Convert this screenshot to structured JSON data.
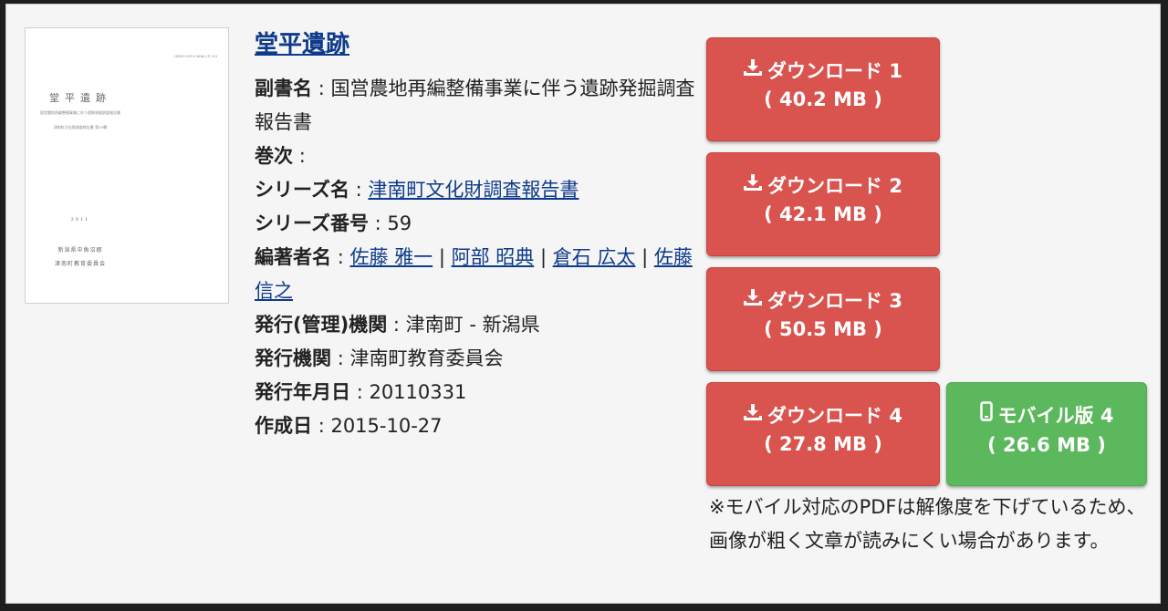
{
  "thumbnail": {
    "code": "ISSN-0919-3686 (1) 59",
    "title": "堂平遺跡",
    "subtitle": "国営農地再編整備事業に伴う遺跡発掘調査報告書",
    "series": "津南町文化財調査報告書 第59輯",
    "year": "2011",
    "publisher1": "新潟県中魚沼郡",
    "publisher2": "津南町教育委員会"
  },
  "title": "堂平遺跡",
  "fields": {
    "subtitle_label": "副書名",
    "subtitle_value": "国営農地再編整備事業に伴う遺跡発掘調査報告書",
    "volume_label": "巻次",
    "volume_value": "",
    "series_label": "シリーズ名",
    "series_value": "津南町文化財調査報告書",
    "series_no_label": "シリーズ番号",
    "series_no_value": "59",
    "authors_label": "編著者名",
    "authors": [
      "佐藤 雅一",
      "阿部 昭典",
      "倉石 広太",
      "佐藤 信之"
    ],
    "org_label": "発行(管理)機関",
    "org_value": "津南町 - 新潟県",
    "publisher_label": "発行機関",
    "publisher_value": "津南町教育委員会",
    "date_label": "発行年月日",
    "date_value": "20110331",
    "created_label": "作成日",
    "created_value": "2015-10-27",
    "separator": ":"
  },
  "downloads": [
    {
      "label": "ダウンロード 1",
      "size": "( 40.2 MB )"
    },
    {
      "label": "ダウンロード 2",
      "size": "( 42.1 MB )"
    },
    {
      "label": "ダウンロード 3",
      "size": "( 50.5 MB )"
    },
    {
      "label": "ダウンロード 4",
      "size": "( 27.8 MB )"
    }
  ],
  "mobile": {
    "label": "モバイル版 4",
    "size": "( 26.6 MB )"
  },
  "note": "※モバイル対応のPDFは解像度を下げているため、画像が粗く文章が読みにくい場合があります。",
  "colors": {
    "download": "#d9534f",
    "mobile": "#5cb85c",
    "link": "#0d3a8a"
  },
  "icons": {
    "download": "download-icon",
    "mobile": "mobile-phone-icon"
  }
}
